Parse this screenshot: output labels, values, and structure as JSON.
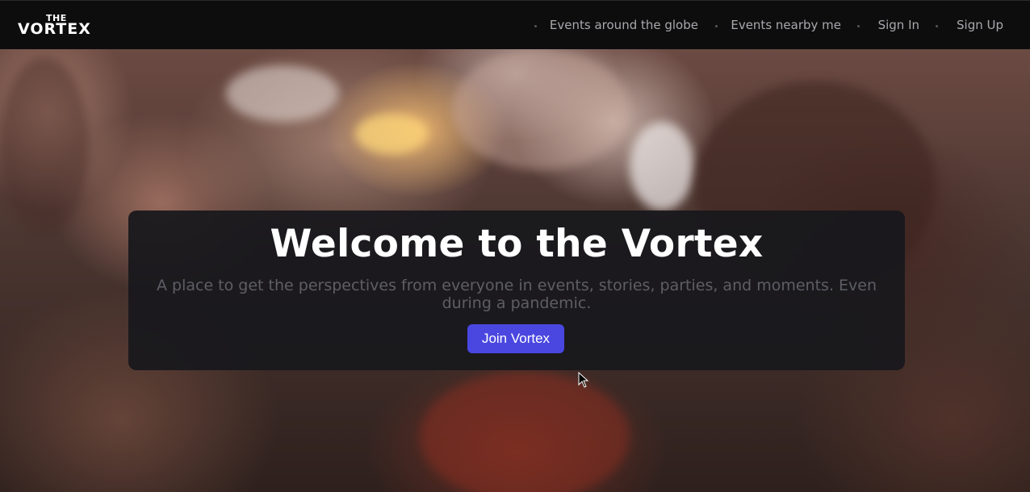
{
  "brand": {
    "logo_top": "THE",
    "logo_bottom": "VORTEX"
  },
  "nav": {
    "items": [
      {
        "label": "Events around the globe"
      },
      {
        "label": "Events nearby me"
      },
      {
        "label": "Sign In"
      },
      {
        "label": "Sign Up"
      }
    ]
  },
  "hero": {
    "title": "Welcome to the Vortex",
    "subtitle": "A place to get the perspectives from everyone in events, stories, parties, and moments. Even during a pandemic.",
    "button_label": "Join Vortex"
  },
  "colors": {
    "navbar_bg": "#0d0d0e",
    "card_bg": "#18181c",
    "accent": "#4a47e0",
    "nav_text": "#a9a9ae",
    "subtitle_text": "#5e5e66"
  },
  "icons": {
    "cursor": "mouse-pointer-icon"
  }
}
